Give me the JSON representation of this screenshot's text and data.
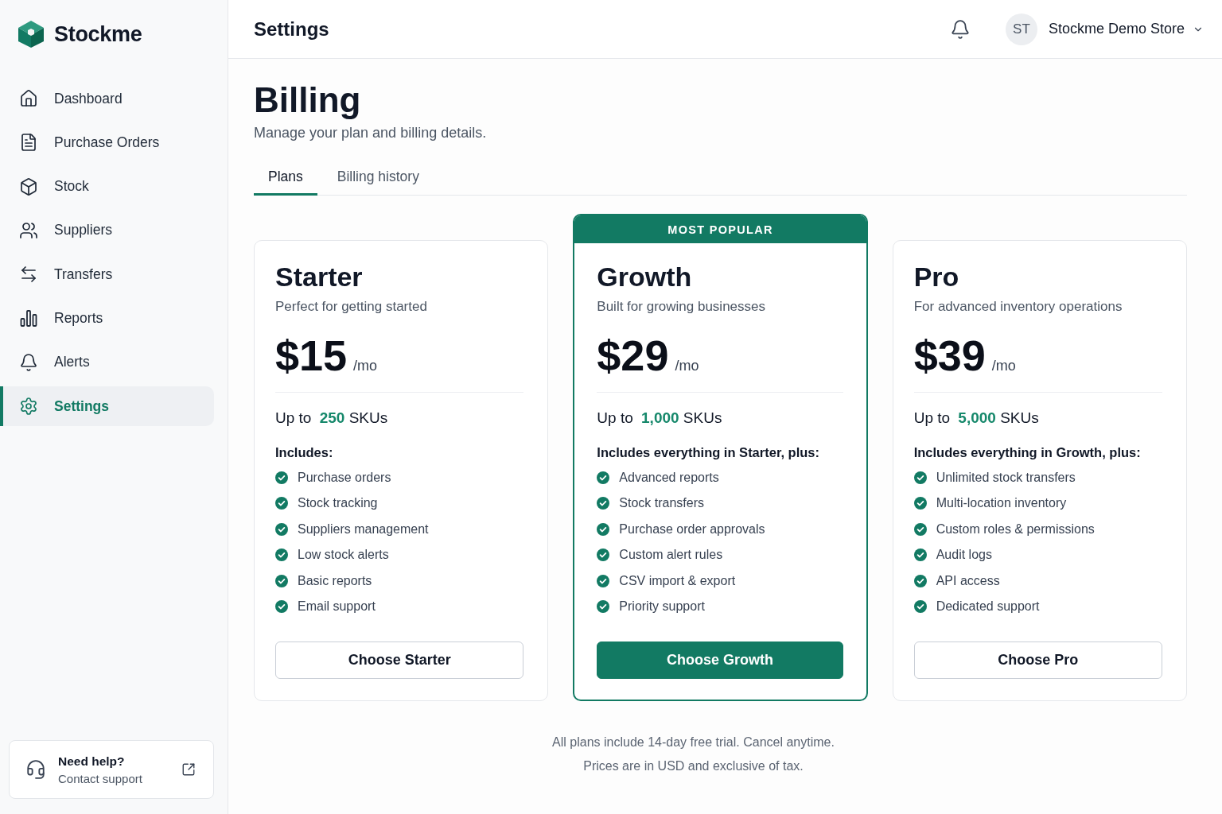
{
  "brand": {
    "name": "Stockme"
  },
  "sidebar": {
    "items": [
      {
        "label": "Dashboard",
        "selected": false
      },
      {
        "label": "Purchase Orders",
        "selected": false
      },
      {
        "label": "Stock",
        "selected": false
      },
      {
        "label": "Suppliers",
        "selected": false
      },
      {
        "label": "Transfers",
        "selected": false
      },
      {
        "label": "Reports",
        "selected": false
      },
      {
        "label": "Alerts",
        "selected": false
      },
      {
        "label": "Settings",
        "selected": true
      }
    ],
    "help_card": {
      "title": "Need help?",
      "subtitle": "Contact support"
    }
  },
  "header": {
    "title": "Settings",
    "account": {
      "initials": "ST",
      "name": "Stockme Demo Store"
    }
  },
  "page": {
    "title": "Billing",
    "subtitle": "Manage your plan and billing details."
  },
  "tabs": [
    {
      "label": "Plans",
      "selected": true
    },
    {
      "label": "Billing history",
      "selected": false
    }
  ],
  "plans": [
    {
      "name": "Starter",
      "featured": false,
      "tagline": "Perfect for getting started",
      "price": "$15",
      "period": "/mo",
      "sku_limit": {
        "prefix": "Up to",
        "count": "250",
        "suffix": "SKUs"
      },
      "includes_heading": "Includes:",
      "features": [
        "Purchase orders",
        "Stock tracking",
        "Suppliers management",
        "Low stock alerts",
        "Basic reports",
        "Email support"
      ],
      "button": "Choose Starter"
    },
    {
      "name": "Growth",
      "featured": true,
      "badge": "MOST POPULAR",
      "tagline": "Built for growing businesses",
      "price": "$29",
      "period": "/mo",
      "sku_limit": {
        "prefix": "Up to",
        "count": "1,000",
        "suffix": "SKUs"
      },
      "includes_heading": "Includes everything in Starter, plus:",
      "features": [
        "Advanced reports",
        "Stock transfers",
        "Purchase order approvals",
        "Custom alert rules",
        "CSV import & export",
        "Priority support"
      ],
      "button": "Choose Growth"
    },
    {
      "name": "Pro",
      "featured": false,
      "tagline": "For advanced inventory operations",
      "price": "$39",
      "period": "/mo",
      "sku_limit": {
        "prefix": "Up to",
        "count": "5,000",
        "suffix": "SKUs"
      },
      "includes_heading": "Includes everything in Growth, plus:",
      "features": [
        "Unlimited stock transfers",
        "Multi-location inventory",
        "Custom roles & permissions",
        "Audit logs",
        "API access",
        "Dedicated support"
      ],
      "button": "Choose Pro"
    }
  ],
  "footnotes": [
    "All plans include 14-day free trial. Cancel anytime.",
    "Prices are in USD and exclusive of tax."
  ]
}
